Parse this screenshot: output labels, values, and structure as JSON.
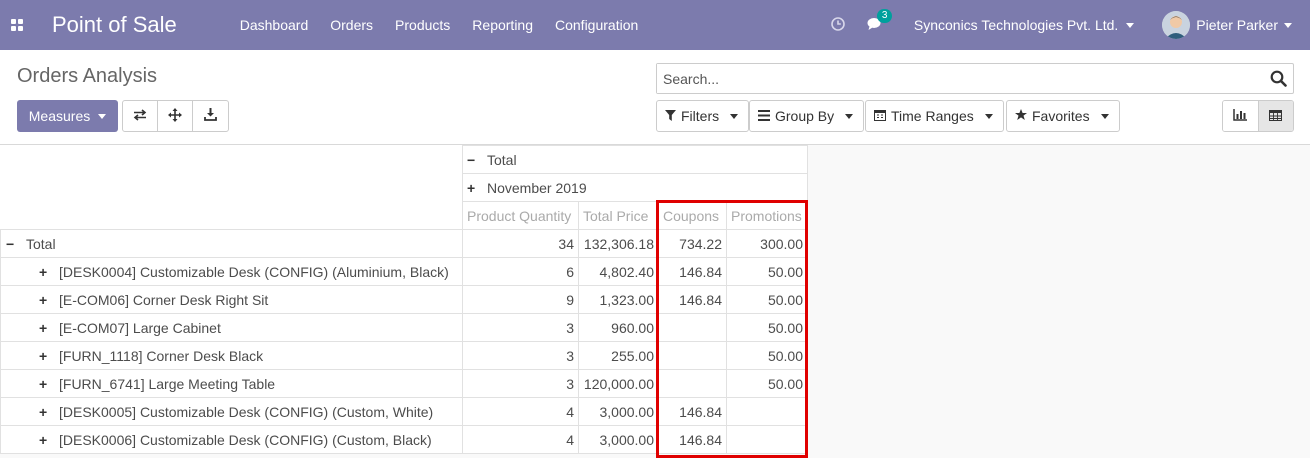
{
  "navbar": {
    "brand": "Point of Sale",
    "menu": [
      "Dashboard",
      "Orders",
      "Products",
      "Reporting",
      "Configuration"
    ],
    "chat_count": "3",
    "company": "Synconics Technologies Pvt. Ltd.",
    "user": "Pieter Parker",
    "bg_color": "#7c7bad"
  },
  "control_panel": {
    "title": "Orders Analysis",
    "measures_label": "Measures",
    "search_placeholder": "Search...",
    "filters_label": "Filters",
    "groupby_label": "Group By",
    "timeranges_label": "Time Ranges",
    "favorites_label": "Favorites"
  },
  "pivot": {
    "col_total": "Total",
    "col_group": "November 2019",
    "measures": [
      "Product Quantity",
      "Total Price",
      "Coupons",
      "Promotions"
    ],
    "row_total": {
      "label": "Total",
      "values": [
        "34",
        "132,306.18",
        "734.22",
        "300.00"
      ]
    },
    "rows": [
      {
        "label": "[DESK0004] Customizable Desk (CONFIG) (Aluminium, Black)",
        "values": [
          "6",
          "4,802.40",
          "146.84",
          "50.00"
        ]
      },
      {
        "label": "[E-COM06] Corner Desk Right Sit",
        "values": [
          "9",
          "1,323.00",
          "146.84",
          "50.00"
        ]
      },
      {
        "label": "[E-COM07] Large Cabinet",
        "values": [
          "3",
          "960.00",
          "",
          "50.00"
        ]
      },
      {
        "label": "[FURN_1118] Corner Desk Black",
        "values": [
          "3",
          "255.00",
          "",
          "50.00"
        ]
      },
      {
        "label": "[FURN_6741] Large Meeting Table",
        "values": [
          "3",
          "120,000.00",
          "",
          "50.00"
        ]
      },
      {
        "label": "[DESK0005] Customizable Desk (CONFIG) (Custom, White)",
        "values": [
          "4",
          "3,000.00",
          "146.84",
          ""
        ]
      },
      {
        "label": "[DESK0006] Customizable Desk (CONFIG) (Custom, Black)",
        "values": [
          "4",
          "3,000.00",
          "146.84",
          ""
        ]
      }
    ],
    "highlight_color": "#e00000"
  }
}
